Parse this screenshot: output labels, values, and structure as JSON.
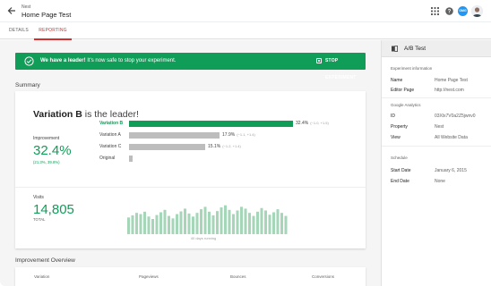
{
  "header": {
    "breadcrumb": "Nest",
    "page_title": "Home Page Test",
    "org_badge": "OMG"
  },
  "tabs": [
    {
      "label": "DETAILS",
      "active": false
    },
    {
      "label": "REPORTING",
      "active": true
    }
  ],
  "banner": {
    "bold_text": "We have a leader!",
    "text": " It's now safe to stop your experiment.",
    "button_label": "STOP EXPERIMENT",
    "color": "#0f9d58"
  },
  "summary": {
    "section_title": "Summary",
    "leader_name": "Variation B",
    "leader_suffix": " is the leader!",
    "improvement_label": "Improvement",
    "improvement_value": "32.4%",
    "improvement_range": "(21.3%, 39.8%)",
    "variations": [
      {
        "name": "Variation B",
        "value": "32.4%",
        "ci": "(−1.0, +1.5)",
        "fraction": 1.0,
        "leader": true
      },
      {
        "name": "Variation A",
        "value": "17.9%",
        "ci": "(−1.1, +1.4)",
        "fraction": 0.553,
        "leader": false
      },
      {
        "name": "Variation C",
        "value": "15.1%",
        "ci": "(−1.2, +1.4)",
        "fraction": 0.466,
        "leader": false
      },
      {
        "name": "Original",
        "value": "",
        "ci": "",
        "fraction": 0.02,
        "leader": false
      }
    ],
    "visits_label": "Visits",
    "visits_value": "14,805",
    "visits_total_label": "TOTAL",
    "visits_caption": "40 days running",
    "visits_daily": [
      0.55,
      0.62,
      0.7,
      0.66,
      0.74,
      0.58,
      0.5,
      0.63,
      0.72,
      0.8,
      0.6,
      0.52,
      0.66,
      0.75,
      0.84,
      0.68,
      0.58,
      0.7,
      0.82,
      0.9,
      0.74,
      0.62,
      0.76,
      0.88,
      0.95,
      0.8,
      0.66,
      0.78,
      0.9,
      0.84,
      0.7,
      0.6,
      0.74,
      0.86,
      0.78,
      0.64,
      0.72,
      0.82,
      0.7,
      0.6
    ]
  },
  "overview": {
    "section_title": "Improvement Overview",
    "columns": [
      "Variation",
      "Pageviews",
      "Bounces",
      "Conversions"
    ]
  },
  "panel": {
    "title": "A/B Test",
    "sections": {
      "experiment": "Experiment information",
      "analytics": "Google Analytics",
      "schedule": "Schedule"
    },
    "experiment": [
      {
        "key": "Name",
        "value": "Home Page Test"
      },
      {
        "key": "Editor Page",
        "value": "http://nest.com"
      }
    ],
    "analytics": [
      {
        "key": "ID",
        "value": "03Xlx7V0a2Z5jwnv0"
      },
      {
        "key": "Property",
        "value": "Nest"
      },
      {
        "key": "View",
        "value": "All Website Data"
      }
    ],
    "schedule": [
      {
        "key": "Start Date",
        "value": "January 6, 2015"
      },
      {
        "key": "End Date",
        "value": "None"
      }
    ]
  }
}
